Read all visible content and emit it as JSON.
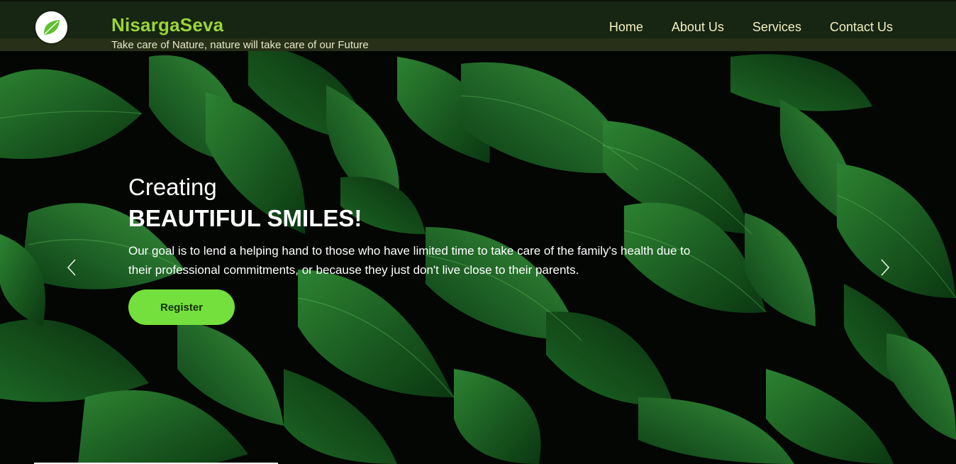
{
  "header": {
    "brand": "NisargaSeva",
    "tagline": "Take care of Nature, nature will take care of our Future",
    "logo_icon": "leaf-icon",
    "brand_color": "#9ad43a"
  },
  "nav": {
    "items": [
      {
        "label": "Home"
      },
      {
        "label": "About Us"
      },
      {
        "label": "Services"
      },
      {
        "label": "Contact Us"
      }
    ]
  },
  "hero": {
    "subtitle": "Creating",
    "title": "BEAUTIFUL SMILES!",
    "description": "Our goal is to lend a helping hand to those who have limited time to take care of the family's health due to their professional commitments, or because they just don't live close to their parents.",
    "register_label": "Register",
    "accent_color": "#74e03d",
    "prev_icon": "chevron-left-icon",
    "next_icon": "chevron-right-icon"
  }
}
